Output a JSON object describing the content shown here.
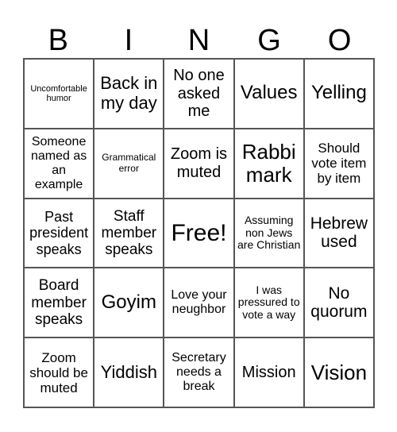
{
  "header": [
    "B",
    "I",
    "N",
    "G",
    "O"
  ],
  "cells": [
    "Uncomfortable humor",
    "Back in my day",
    "No one asked me",
    "Values",
    "Yelling",
    "Someone named as an example",
    "Grammatical error",
    "Zoom is muted",
    "Rabbi mark",
    "Should vote item by item",
    "Past president speaks",
    "Staff member speaks",
    "Free!",
    "Assuming non Jews are Christian",
    "Hebrew used",
    "Board member speaks",
    "Goyim",
    "Love your neughbor",
    "I was pressured to vote a way",
    "No quorum",
    "Zoom should be muted",
    "Yiddish",
    "Secretary needs a break",
    "Mission",
    "Vision"
  ]
}
